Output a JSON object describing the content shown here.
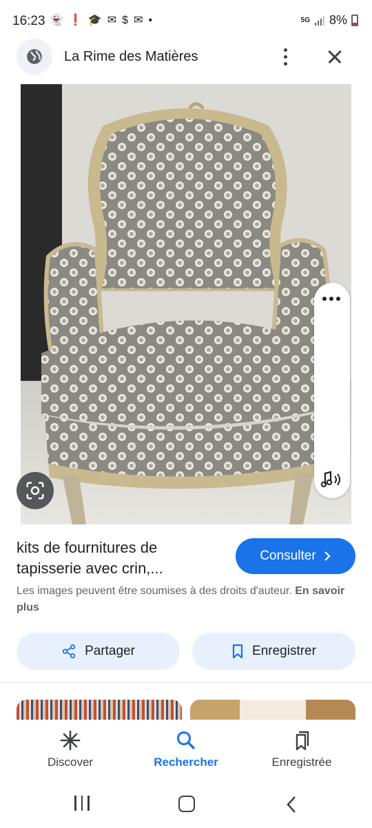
{
  "status_bar": {
    "time": "16:23",
    "network_label": "5G",
    "battery_percent": "8%",
    "notification_icons": [
      "snapchat-icon",
      "alert-icon",
      "graduation-icon",
      "mail-icon",
      "dollar-icon",
      "mail-icon",
      "dot-icon"
    ]
  },
  "header": {
    "site_name": "La Rime des Matières"
  },
  "result": {
    "title": "kits de fournitures de tapisserie avec crin,...",
    "consult_label": "Consulter",
    "copyright_text": "Les images peuvent être soumises à des droits d'auteur.",
    "learn_more": "En savoir plus"
  },
  "actions": {
    "share_label": "Partager",
    "save_label": "Enregistrer"
  },
  "bottom_nav": {
    "items": [
      {
        "label": "Discover",
        "icon": "asterisk-icon"
      },
      {
        "label": "Rechercher",
        "icon": "search-icon",
        "active": true
      },
      {
        "label": "Enregistrée",
        "icon": "bookmarks-icon"
      }
    ]
  },
  "colors": {
    "accent": "#1a73e8",
    "chip_bg": "#e8f0fe"
  }
}
